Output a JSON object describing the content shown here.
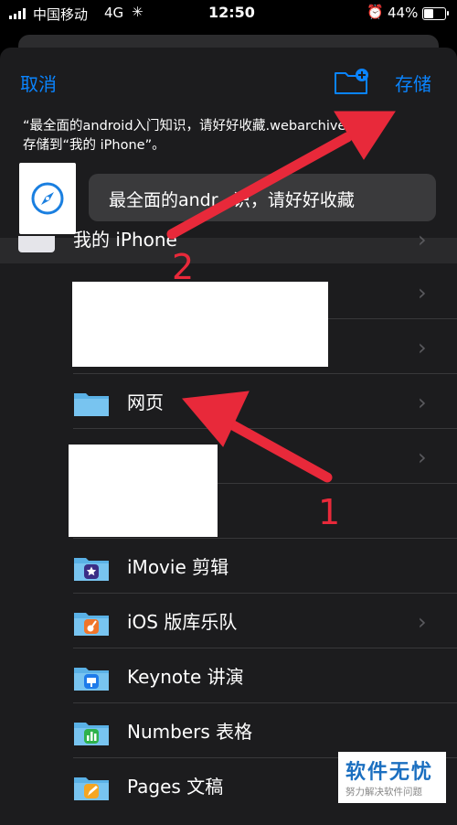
{
  "status_bar": {
    "carrier": "中国移动",
    "network": "4G",
    "time": "12:50",
    "battery_pct": "44%",
    "battery_level": 0.44
  },
  "nav": {
    "cancel_label": "取消",
    "save_label": "存储"
  },
  "description": {
    "line1": "“最全面的android入门知识，请好好收藏.webarchive”将",
    "line2": "存储到“我的 iPhone”。"
  },
  "file_name": "最全面的andr...识，请好好收藏",
  "locations": {
    "root_label": "我的 iPhone",
    "items": [
      {
        "label": "网页",
        "chevron": true
      },
      {
        "label": "iMovie 剪辑",
        "chevron": false
      },
      {
        "label": "iOS 版库乐队",
        "chevron": true
      },
      {
        "label": "Keynote 讲演",
        "chevron": false
      },
      {
        "label": "Numbers 表格",
        "chevron": false
      },
      {
        "label": "Pages 文稿",
        "chevron": false
      }
    ]
  },
  "annotations": {
    "step1": "1",
    "step2": "2"
  },
  "watermark": {
    "main": "软件无忧",
    "sub": "努力解决软件问题"
  },
  "colors": {
    "accent": "#0a84ff",
    "annotation": "#e8293a",
    "sheet": "#1c1c1e"
  }
}
